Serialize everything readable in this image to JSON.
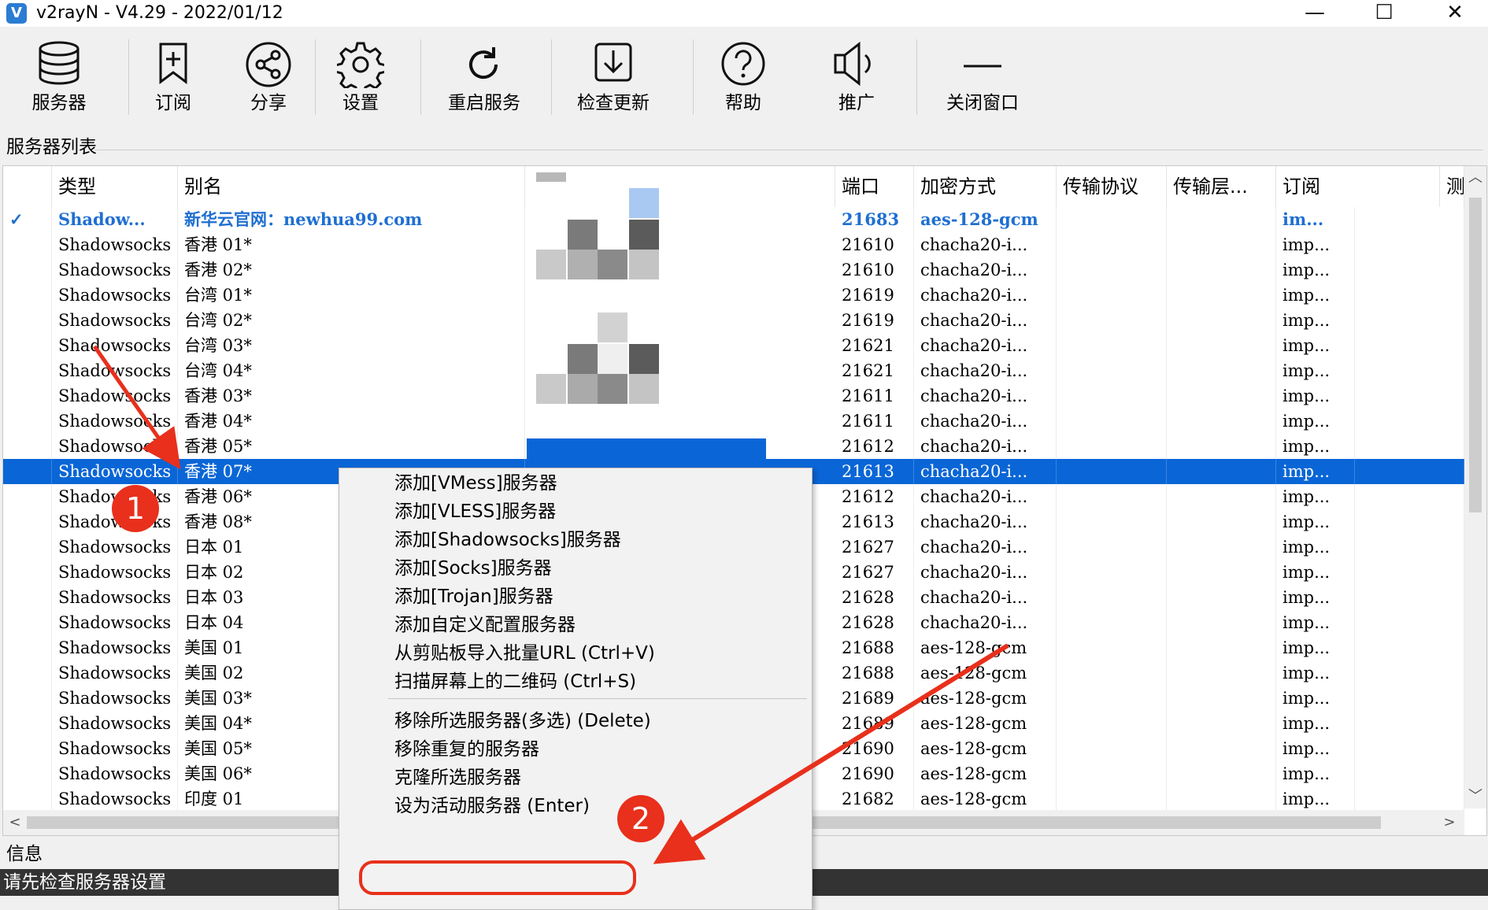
{
  "window": {
    "title": "v2rayN - V4.29 - 2022/01/12",
    "app_icon_letter": "V",
    "minimize": "—",
    "maximize": "☐",
    "close": "✕"
  },
  "toolbar": {
    "servers": "服务器",
    "subscribe": "订阅",
    "share": "分享",
    "settings": "设置",
    "restart_service": "重启服务",
    "check_update": "检查更新",
    "help": "帮助",
    "promote": "推广",
    "close_window": "关闭窗口"
  },
  "server_list": {
    "label": "服务器列表",
    "columns": [
      "类型",
      "别名",
      "",
      "端口",
      "加密方式",
      "传输协议",
      "传输层...",
      "订阅",
      "测试"
    ],
    "rows": [
      {
        "check": "✓",
        "type": "Shadow...",
        "alias": "新华云官网：newhua99.com",
        "port": "21683",
        "encrypt": "aes-128-gcm",
        "sub": "im..."
      },
      {
        "check": "",
        "type": "Shadowsocks",
        "alias": "香港 01*",
        "port": "21610",
        "encrypt": "chacha20-i...",
        "sub": "imp..."
      },
      {
        "check": "",
        "type": "Shadowsocks",
        "alias": "香港 02*",
        "port": "21610",
        "encrypt": "chacha20-i...",
        "sub": "imp..."
      },
      {
        "check": "",
        "type": "Shadowsocks",
        "alias": "台湾 01*",
        "port": "21619",
        "encrypt": "chacha20-i...",
        "sub": "imp..."
      },
      {
        "check": "",
        "type": "Shadowsocks",
        "alias": "台湾 02*",
        "port": "21619",
        "encrypt": "chacha20-i...",
        "sub": "imp..."
      },
      {
        "check": "",
        "type": "Shadowsocks",
        "alias": "台湾 03*",
        "port": "21621",
        "encrypt": "chacha20-i...",
        "sub": "imp..."
      },
      {
        "check": "",
        "type": "Shadowsocks",
        "alias": "台湾 04*",
        "port": "21621",
        "encrypt": "chacha20-i...",
        "sub": "imp..."
      },
      {
        "check": "",
        "type": "Shadowsocks",
        "alias": "香港 03*",
        "port": "21611",
        "encrypt": "chacha20-i...",
        "sub": "imp..."
      },
      {
        "check": "",
        "type": "Shadowsocks",
        "alias": "香港 04*",
        "port": "21611",
        "encrypt": "chacha20-i...",
        "sub": "imp..."
      },
      {
        "check": "",
        "type": "Shadowsocks",
        "alias": "香港 05*",
        "port": "21612",
        "encrypt": "chacha20-i...",
        "sub": "imp..."
      },
      {
        "check": "",
        "type": "Shadowsocks",
        "alias": "香港 07*",
        "port": "21613",
        "encrypt": "chacha20-i...",
        "sub": "imp..."
      },
      {
        "check": "",
        "type": "Shadowsocks",
        "alias": "香港 06*",
        "port": "21612",
        "encrypt": "chacha20-i...",
        "sub": "imp..."
      },
      {
        "check": "",
        "type": "Shadowsocks",
        "alias": "香港 08*",
        "port": "21613",
        "encrypt": "chacha20-i...",
        "sub": "imp..."
      },
      {
        "check": "",
        "type": "Shadowsocks",
        "alias": "日本 01",
        "port": "21627",
        "encrypt": "chacha20-i...",
        "sub": "imp..."
      },
      {
        "check": "",
        "type": "Shadowsocks",
        "alias": "日本 02",
        "port": "21627",
        "encrypt": "chacha20-i...",
        "sub": "imp..."
      },
      {
        "check": "",
        "type": "Shadowsocks",
        "alias": "日本 03",
        "port": "21628",
        "encrypt": "chacha20-i...",
        "sub": "imp..."
      },
      {
        "check": "",
        "type": "Shadowsocks",
        "alias": "日本 04",
        "port": "21628",
        "encrypt": "chacha20-i...",
        "sub": "imp..."
      },
      {
        "check": "",
        "type": "Shadowsocks",
        "alias": "美国 01",
        "port": "21688",
        "encrypt": "aes-128-gcm",
        "sub": "imp..."
      },
      {
        "check": "",
        "type": "Shadowsocks",
        "alias": "美国 02",
        "port": "21688",
        "encrypt": "aes-128-gcm",
        "sub": "imp..."
      },
      {
        "check": "",
        "type": "Shadowsocks",
        "alias": "美国 03*",
        "port": "21689",
        "encrypt": "aes-128-gcm",
        "sub": "imp..."
      },
      {
        "check": "",
        "type": "Shadowsocks",
        "alias": "美国 04*",
        "port": "21689",
        "encrypt": "aes-128-gcm",
        "sub": "imp..."
      },
      {
        "check": "",
        "type": "Shadowsocks",
        "alias": "美国 05*",
        "port": "21690",
        "encrypt": "aes-128-gcm",
        "sub": "imp..."
      },
      {
        "check": "",
        "type": "Shadowsocks",
        "alias": "美国 06*",
        "port": "21690",
        "encrypt": "aes-128-gcm",
        "sub": "imp..."
      },
      {
        "check": "",
        "type": "Shadowsocks",
        "alias": "印度 01",
        "port": "21682",
        "encrypt": "aes-128-gcm",
        "sub": "imp..."
      }
    ],
    "active_index": 0,
    "selected_index": 10
  },
  "context_menu": {
    "items": [
      "添加[VMess]服务器",
      "添加[VLESS]服务器",
      "添加[Shadowsocks]服务器",
      "添加[Socks]服务器",
      "添加[Trojan]服务器",
      "添加自定义配置服务器",
      "从剪贴板导入批量URL (Ctrl+V)",
      "扫描屏幕上的二维码 (Ctrl+S)",
      "移除所选服务器(多选) (Delete)",
      "移除重复的服务器",
      "克隆所选服务器",
      "设为活动服务器 (Enter)"
    ]
  },
  "info": {
    "label": "信息",
    "status": "请先检查服务器设置"
  },
  "annotations": {
    "badge1": "1",
    "badge2": "2",
    "color": "#e8301c"
  },
  "colors": {
    "selection": "#0a66d6",
    "active_text": "#1f6fd1"
  }
}
